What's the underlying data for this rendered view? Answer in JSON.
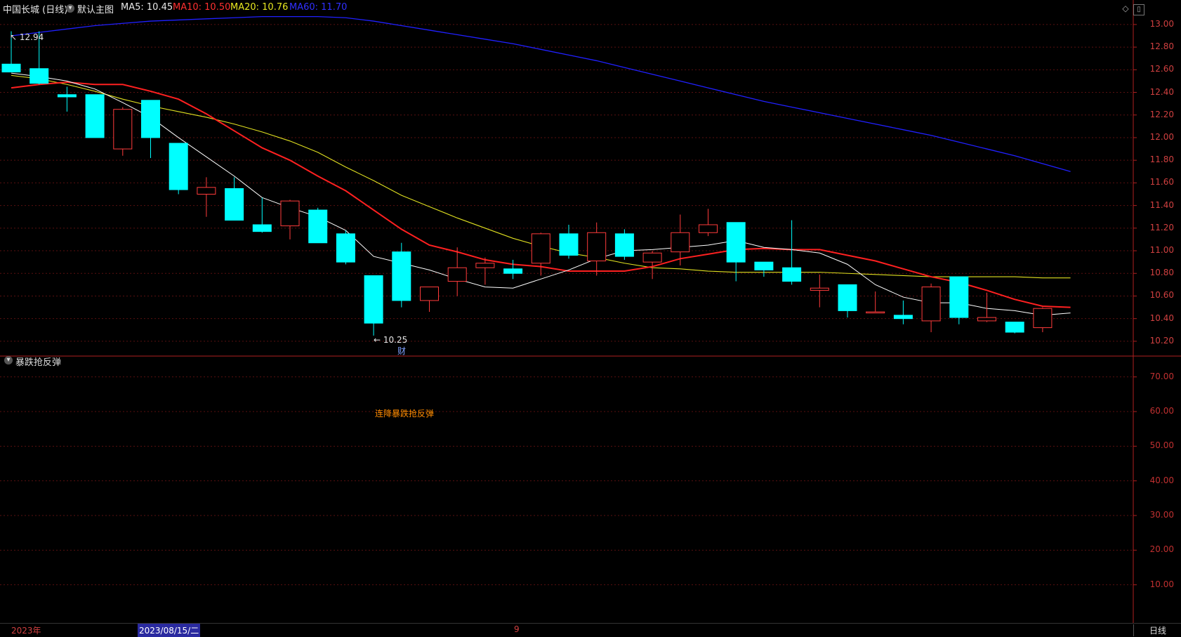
{
  "header": {
    "stock_name": "中国长城 (日线)",
    "main_chart_label": "默认主图",
    "ma5": "MA5: 10.45",
    "ma10": "MA10: 10.50",
    "ma20": "MA20: 10.76",
    "ma60": "MA60: 11.70"
  },
  "indicator": {
    "title": "暴跌抢反弹",
    "signal_label": "连降暴跌抢反弹",
    "signal_value": 70
  },
  "annotations": {
    "high_label": "12.94",
    "low_label": "10.25",
    "finance_marker": "财"
  },
  "axis": {
    "price_ticks": [
      "13.00",
      "12.80",
      "12.60",
      "12.40",
      "12.20",
      "12.00",
      "11.80",
      "11.60",
      "11.40",
      "11.20",
      "11.00",
      "10.80",
      "10.60",
      "10.40",
      "10.20"
    ],
    "indicator_ticks": [
      "70.00",
      "60.00",
      "50.00",
      "40.00",
      "30.00",
      "20.00",
      "10.00"
    ]
  },
  "footer": {
    "year_label": "2023年",
    "date_label": "2023/08/15/二",
    "month_marker": "9",
    "period_label": "日线"
  },
  "colors": {
    "up": "#ff3b3b",
    "down": "#00ffff",
    "ma5": "#ffffff",
    "ma10": "#ff2020",
    "ma20": "#e0e020",
    "ma60": "#2020ff",
    "signal": "#ff8c00"
  },
  "chart_data": {
    "type": "candlestick",
    "candles": [
      {
        "o": 12.65,
        "h": 12.94,
        "l": 12.58,
        "c": 12.58
      },
      {
        "o": 12.61,
        "h": 12.94,
        "l": 12.47,
        "c": 12.48
      },
      {
        "o": 12.38,
        "h": 12.45,
        "l": 12.23,
        "c": 12.36
      },
      {
        "o": 12.38,
        "h": 12.38,
        "l": 12.0,
        "c": 12.0
      },
      {
        "o": 11.9,
        "h": 12.27,
        "l": 11.84,
        "c": 12.25
      },
      {
        "o": 12.33,
        "h": 12.33,
        "l": 11.82,
        "c": 12.0
      },
      {
        "o": 11.95,
        "h": 11.95,
        "l": 11.5,
        "c": 11.54
      },
      {
        "o": 11.5,
        "h": 11.65,
        "l": 11.3,
        "c": 11.56
      },
      {
        "o": 11.55,
        "h": 11.65,
        "l": 11.27,
        "c": 11.27
      },
      {
        "o": 11.23,
        "h": 11.47,
        "l": 11.16,
        "c": 11.17
      },
      {
        "o": 11.22,
        "h": 11.45,
        "l": 11.1,
        "c": 11.44
      },
      {
        "o": 11.36,
        "h": 11.38,
        "l": 11.07,
        "c": 11.07
      },
      {
        "o": 11.15,
        "h": 11.18,
        "l": 10.88,
        "c": 10.9
      },
      {
        "o": 10.78,
        "h": 10.78,
        "l": 10.25,
        "c": 10.36
      },
      {
        "o": 10.99,
        "h": 11.07,
        "l": 10.5,
        "c": 10.56
      },
      {
        "o": 10.56,
        "h": 10.68,
        "l": 10.46,
        "c": 10.68
      },
      {
        "o": 10.73,
        "h": 11.03,
        "l": 10.6,
        "c": 10.85
      },
      {
        "o": 10.85,
        "h": 10.94,
        "l": 10.7,
        "c": 10.89
      },
      {
        "o": 10.84,
        "h": 10.92,
        "l": 10.75,
        "c": 10.8
      },
      {
        "o": 10.89,
        "h": 11.16,
        "l": 10.78,
        "c": 11.15
      },
      {
        "o": 11.15,
        "h": 11.23,
        "l": 10.93,
        "c": 10.96
      },
      {
        "o": 10.91,
        "h": 11.25,
        "l": 10.78,
        "c": 11.16
      },
      {
        "o": 11.15,
        "h": 11.19,
        "l": 10.92,
        "c": 10.95
      },
      {
        "o": 10.9,
        "h": 11.0,
        "l": 10.75,
        "c": 10.98
      },
      {
        "o": 10.99,
        "h": 11.32,
        "l": 10.87,
        "c": 11.16
      },
      {
        "o": 11.16,
        "h": 11.37,
        "l": 11.13,
        "c": 11.23
      },
      {
        "o": 11.25,
        "h": 11.25,
        "l": 10.73,
        "c": 10.9
      },
      {
        "o": 10.9,
        "h": 10.9,
        "l": 10.77,
        "c": 10.83
      },
      {
        "o": 10.85,
        "h": 11.27,
        "l": 10.7,
        "c": 10.73
      },
      {
        "o": 10.65,
        "h": 10.79,
        "l": 10.5,
        "c": 10.67
      },
      {
        "o": 10.7,
        "h": 10.7,
        "l": 10.41,
        "c": 10.47
      },
      {
        "o": 10.45,
        "h": 10.64,
        "l": 10.45,
        "c": 10.46
      },
      {
        "o": 10.43,
        "h": 10.56,
        "l": 10.35,
        "c": 10.4
      },
      {
        "o": 10.38,
        "h": 10.71,
        "l": 10.28,
        "c": 10.68
      },
      {
        "o": 10.77,
        "h": 10.77,
        "l": 10.35,
        "c": 10.41
      },
      {
        "o": 10.38,
        "h": 10.63,
        "l": 10.37,
        "c": 10.41
      },
      {
        "o": 10.37,
        "h": 10.37,
        "l": 10.27,
        "c": 10.28
      },
      {
        "o": 10.32,
        "h": 10.5,
        "l": 10.28,
        "c": 10.49
      }
    ],
    "ma5": [
      12.57,
      12.54,
      12.5,
      12.43,
      12.31,
      12.18,
      12.0,
      11.83,
      11.66,
      11.47,
      11.38,
      11.3,
      11.18,
      10.95,
      10.89,
      10.83,
      10.75,
      10.68,
      10.67,
      10.75,
      10.83,
      10.93,
      11.0,
      11.01,
      11.03,
      11.05,
      11.09,
      11.03,
      11.01,
      10.98,
      10.88,
      10.7,
      10.59,
      10.54,
      10.54,
      10.49,
      10.47,
      10.43,
      10.45
    ],
    "ma10": [
      12.44,
      12.47,
      12.49,
      12.47,
      12.47,
      12.41,
      12.34,
      12.21,
      12.06,
      11.91,
      11.8,
      11.66,
      11.53,
      11.36,
      11.19,
      11.05,
      10.99,
      10.92,
      10.88,
      10.86,
      10.82,
      10.82,
      10.82,
      10.86,
      10.93,
      10.97,
      11.01,
      11.02,
      11.01,
      11.01,
      10.96,
      10.91,
      10.84,
      10.77,
      10.72,
      10.65,
      10.57,
      10.51,
      10.5
    ],
    "ma20": [
      12.55,
      12.52,
      12.47,
      12.41,
      12.34,
      12.28,
      12.23,
      12.18,
      12.12,
      12.05,
      11.97,
      11.87,
      11.74,
      11.62,
      11.49,
      11.39,
      11.29,
      11.2,
      11.11,
      11.04,
      10.98,
      10.94,
      10.89,
      10.85,
      10.84,
      10.82,
      10.81,
      10.81,
      10.81,
      10.81,
      10.8,
      10.79,
      10.78,
      10.77,
      10.77,
      10.77,
      10.77,
      10.76,
      10.76
    ],
    "ma60": [
      12.9,
      12.93,
      12.96,
      12.99,
      13.01,
      13.03,
      13.04,
      13.05,
      13.06,
      13.07,
      13.07,
      13.07,
      13.06,
      13.03,
      12.99,
      12.95,
      12.91,
      12.87,
      12.83,
      12.78,
      12.73,
      12.68,
      12.62,
      12.56,
      12.5,
      12.44,
      12.38,
      12.32,
      12.27,
      12.22,
      12.17,
      12.12,
      12.07,
      12.02,
      11.96,
      11.9,
      11.84,
      11.77,
      11.7
    ],
    "price_ylim": [
      10.1,
      13.08
    ],
    "indicator_ylim": [
      0,
      75
    ],
    "signal_index": 13
  }
}
